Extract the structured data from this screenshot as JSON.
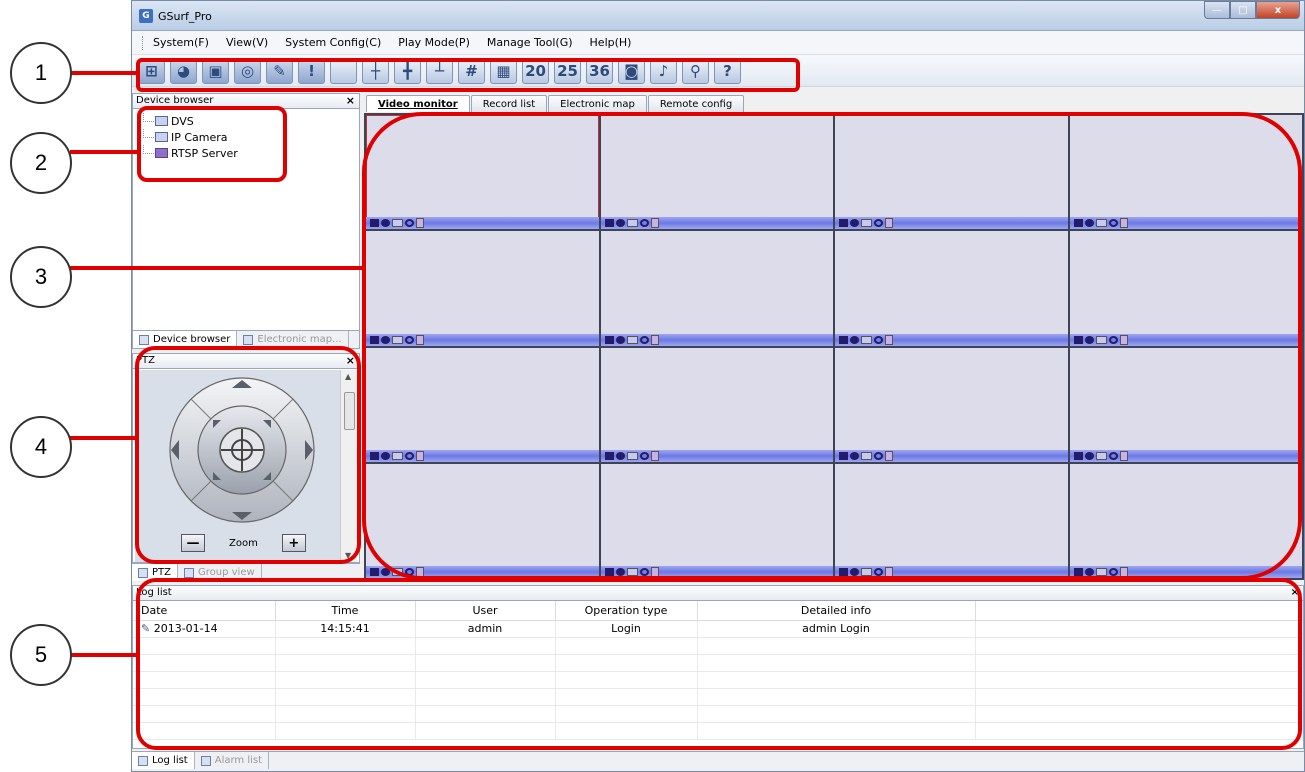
{
  "window": {
    "title": "GSurf_Pro",
    "app_icon": "G",
    "controls": {
      "minimize": "—",
      "maximize": "□",
      "close": "x"
    }
  },
  "menu": [
    "System(F)",
    "View(V)",
    "System Config(C)",
    "Play Mode(P)",
    "Manage Tool(G)",
    "Help(H)"
  ],
  "toolbar": {
    "buttons": [
      {
        "name": "device-tree-icon",
        "glyph": "⊞"
      },
      {
        "name": "globe-icon",
        "glyph": "◕"
      },
      {
        "name": "monitor-icon",
        "glyph": "▣"
      },
      {
        "name": "target-icon",
        "glyph": "◎"
      },
      {
        "name": "config-icon",
        "glyph": "✎"
      },
      {
        "name": "alarm-icon",
        "glyph": "!"
      },
      {
        "name": "layout-1-icon",
        "glyph": ""
      },
      {
        "name": "layout-4-icon",
        "glyph": "┼"
      },
      {
        "name": "layout-6-icon",
        "glyph": "╋"
      },
      {
        "name": "layout-8-icon",
        "glyph": "┴"
      },
      {
        "name": "layout-9-icon",
        "glyph": "#"
      },
      {
        "name": "layout-16-icon",
        "glyph": "▦"
      },
      {
        "name": "layout-20-icon",
        "glyph": "20"
      },
      {
        "name": "layout-25-icon",
        "glyph": "25"
      },
      {
        "name": "layout-36-icon",
        "glyph": "36"
      },
      {
        "name": "snapshot-icon",
        "glyph": "◙"
      },
      {
        "name": "microphone-icon",
        "glyph": "♪"
      },
      {
        "name": "search-icon",
        "glyph": "⚲"
      },
      {
        "name": "help-icon",
        "glyph": "?"
      }
    ]
  },
  "device_browser": {
    "header": "Device browser",
    "close": "×",
    "items": [
      "DVS",
      "IP Camera",
      "RTSP Server"
    ],
    "tabs": [
      "Device browser",
      "Electronic map..."
    ]
  },
  "ptz": {
    "header": "PTZ",
    "close": "×",
    "zoom_label": "Zoom",
    "zoom_out": "—",
    "zoom_in": "+",
    "tabs": [
      "PTZ",
      "Group view"
    ]
  },
  "main_tabs": [
    "Video monitor",
    "Record list",
    "Electronic map",
    "Remote config"
  ],
  "video_grid": {
    "rows": 4,
    "cols": 4,
    "selected_cell": 1
  },
  "log": {
    "header": "Log list",
    "close": "×",
    "columns": [
      "Date",
      "Time",
      "User",
      "Operation type",
      "Detailed info",
      ""
    ],
    "rows": [
      [
        "2013-01-14",
        "14:15:41",
        "admin",
        "Login",
        "admin Login",
        ""
      ]
    ],
    "empty_rows": 6,
    "tabs": [
      "Log list",
      "Alarm list"
    ]
  },
  "callouts": [
    "1",
    "2",
    "3",
    "4",
    "5"
  ],
  "colors": {
    "highlight": "#e00000",
    "grid_bg": "#3e4458",
    "cell_bg": "#dcdcea"
  }
}
